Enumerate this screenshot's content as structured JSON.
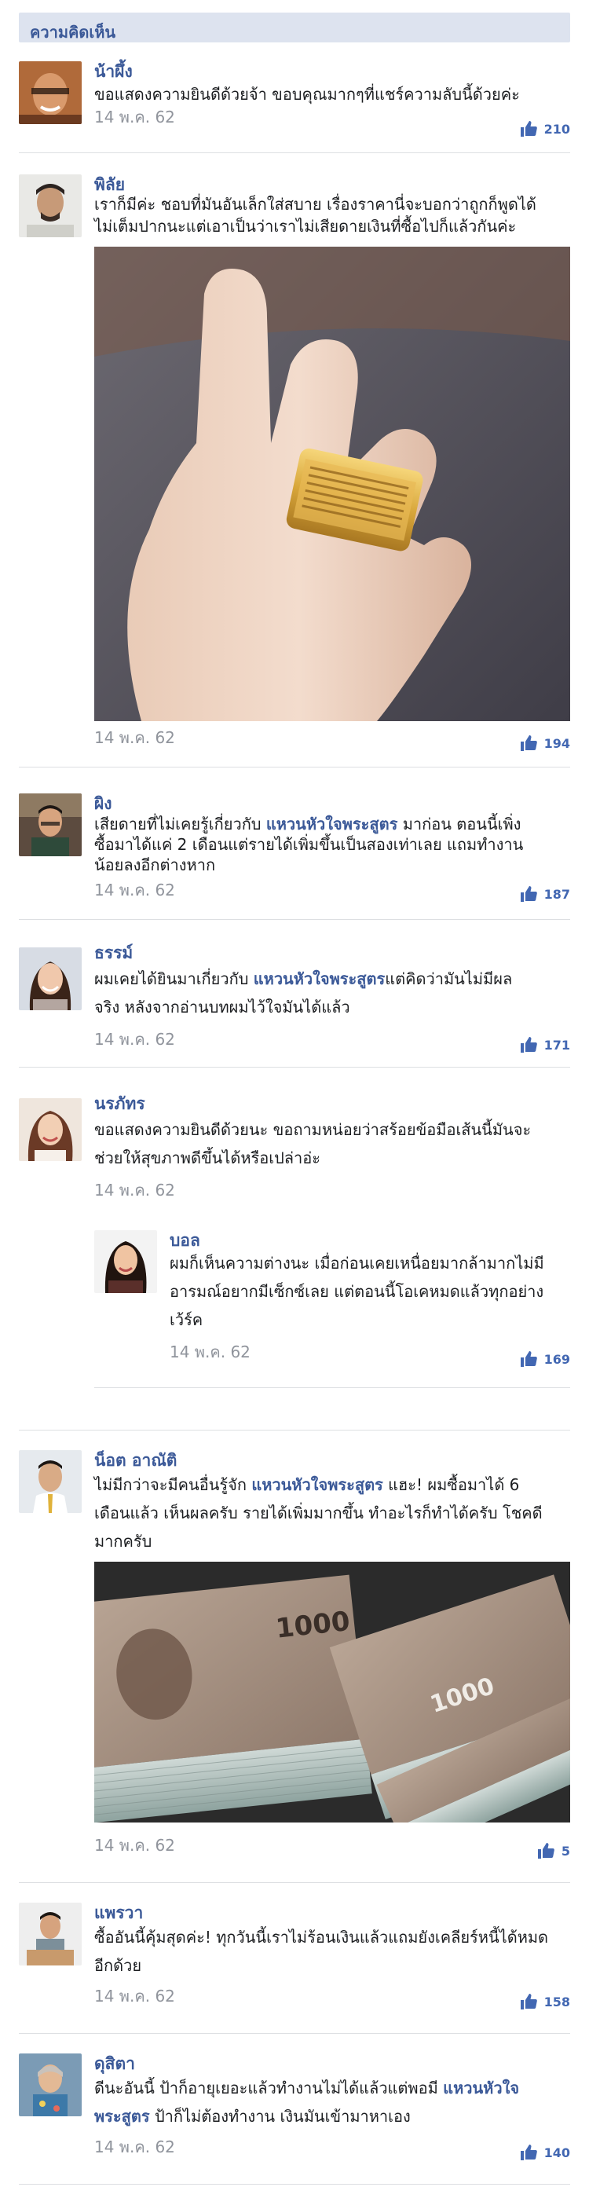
{
  "header": {
    "title": "ความคิดเห็น"
  },
  "comments": [
    {
      "name": "น้าผึ้ง",
      "text": "ขอแสดงความยินดีด้วยจ้า ขอบคุณมากๆที่แชร์ความลับนี้ด้วยค่ะ",
      "date": "14 พ.ค. 62",
      "likes": "210"
    },
    {
      "name": "พิลัย",
      "text_line1": "เราก็มีค่ะ ชอบที่มันอันเล็กใส่สบาย เรื่องราคานี่จะบอกว่าถูกก็พูดได้",
      "text_line2": "ไม่เต็มปากนะแต่เอาเป็นว่าเราไม่เสียดายเงินที่ซื้อไปก็แล้วกันค่ะ",
      "date": "14 พ.ค. 62",
      "likes": "194"
    },
    {
      "name": "ผิง",
      "text_a": "เสียดายที่ไม่เคยรู้เกี่ยวกับ ",
      "keyword": "แหวนหัวใจพระสูตร",
      "text_b": " มาก่อน ตอนนี้เพิ่ง",
      "text_line2": "ซื้อมาได้แค่ 2 เดือนแต่รายได้เพิ่มขึ้นเป็นสองเท่าเลย แถมทำงาน",
      "text_line3": "น้อยลงอีกต่างหาก",
      "date": "14 พ.ค. 62",
      "likes": "187"
    },
    {
      "name": "ธรรม์",
      "text_a": "ผมเคยได้ยินมาเกี่ยวกับ ",
      "keyword": "แหวนหัวใจพระสูตร",
      "text_b": "แต่คิดว่ามันไม่มีผล",
      "text_line2": "จริง หลังจากอ่านบทผมไว้ใจมันได้แล้ว",
      "date": "14 พ.ค. 62",
      "likes": "171"
    },
    {
      "name": "นรภัทร",
      "text_line1": "ขอแสดงความยินดีด้วยนะ ขอถามหน่อยว่าสร้อยข้อมือเส้นนี้มันจะ",
      "text_line2": "ช่วยให้สุขภาพดีขึ้นได้หรือเปล่าอ่ะ",
      "date": "14 พ.ค. 62"
    },
    {
      "name": "บอล",
      "text_line1": "ผมก็เห็นความต่างนะ เมื่อก่อนเคยเหนื่อยมากล้ามากไม่มี",
      "text_line2": "อารมณ์อยากมีเซ็กซ์เลย แต่ตอนนี้โอเคหมดแล้วทุกอย่าง",
      "text_line3": "เว้ร์ค",
      "date": "14 พ.ค. 62",
      "likes": "169"
    },
    {
      "name": "น็อต อาณัติ",
      "text_a": "ไม่มีกว่าจะมีคนอื่นรู้จัก ",
      "keyword": "แหวนหัวใจพระสูตร",
      "text_b": " แฮะ! ผมซื้อมาได้ 6",
      "text_line2": "เดือนแล้ว เห็นผลครับ รายได้เพิ่มมากขึ้น ทำอะไรก็ทำได้ครับ โชคดี",
      "text_line3": "มากครับ",
      "date": "14 พ.ค. 62",
      "likes": "5"
    },
    {
      "name": "แพรวา",
      "text_line1": "ซื้ออันนี้คุ้มสุดค่ะ! ทุกวันนี้เราไม่ร้อนเงินแล้วแถมยังเคลียร์หนี้ได้หมด",
      "text_line2": "อีกด้วย",
      "date": "14 พ.ค. 62",
      "likes": "158"
    },
    {
      "name": "ดุสิตา",
      "text_a": "ดีนะอันนี้ ป้าก็อายุเยอะแล้วทำงานไม่ได้แล้วแต่พอมี ",
      "keyword": "แหวนหัวใจ",
      "keyword2": "พระสูตร",
      "text_b": " ป้าก็ไม่ต้องทำงาน เงินมันเข้ามาหาเอง",
      "date": "14 พ.ค. 62",
      "likes": "140"
    }
  ],
  "banknote_label": "1000",
  "colors": {
    "accent": "#3b5998",
    "like": "#4267b2",
    "header_bg": "#dde3ef",
    "date": "#90949c",
    "divider": "#dddfe2"
  },
  "icons": {
    "like": "thumbs-up-icon"
  }
}
